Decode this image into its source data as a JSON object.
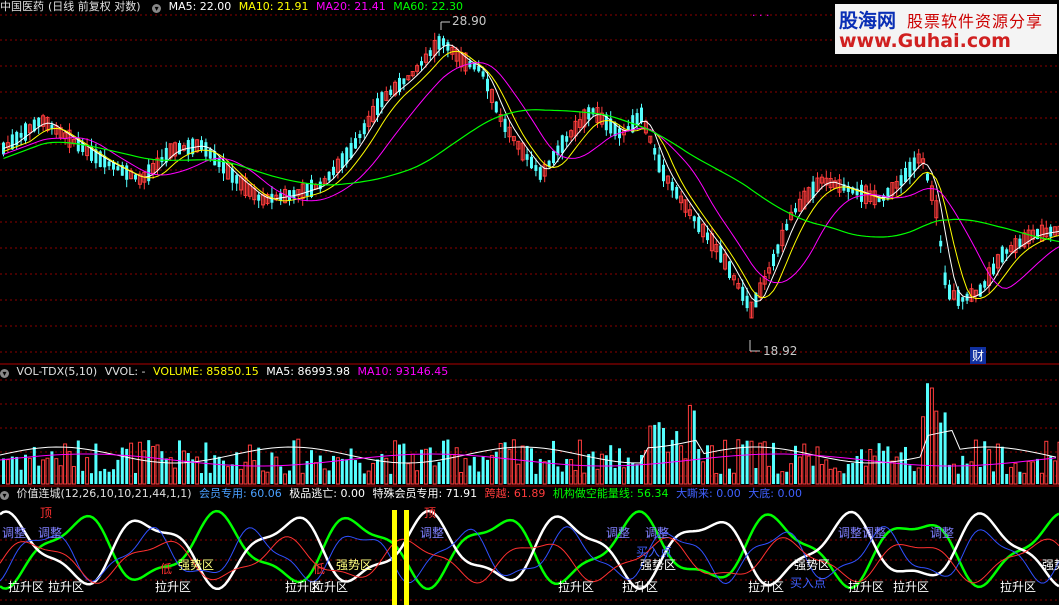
{
  "stock": {
    "name": "中国医药",
    "mode": "(日线 前复权 对数)"
  },
  "ma_header": {
    "ma5": "MA5: 22.00",
    "ma10": "MA10: 21.91",
    "ma20": "MA20: 21.41",
    "ma60": "MA60: 22.30",
    "dots": ". . ."
  },
  "price_marks": {
    "high": "28.90",
    "low": "18.92",
    "cai": "财"
  },
  "vol_header": {
    "name": "VOL-TDX(5,10)",
    "vvol": "VVOL: -",
    "volume": "VOLUME: 85850.15",
    "ma5": "MA5: 86993.98",
    "ma10": "MA10: 93146.45"
  },
  "ind_header": {
    "name": "价值连城(12,26,10,10,21,44,1,1)",
    "member": "会员专用: 60.06",
    "escape": "极品逃亡: 0.00",
    "special": "特殊会员专用: 71.91",
    "cross": "跨越: 61.89",
    "inst": "机构做空能量线: 56.34",
    "bigshort": "大嘶来: 0.00",
    "bigbottom": "大底: 0.00"
  },
  "logo": {
    "brand": "股海网",
    "tagline": "股票软件资源分享",
    "url": "www.Guhai.com"
  },
  "ind_labels": {
    "adjust": "调整",
    "pull": "拉升区",
    "strong": "强势区",
    "top": "顶",
    "low": "低",
    "buy": "买入点"
  },
  "colors": {
    "up": "#ff3c3c",
    "down": "#54ffff",
    "ma5": "#ffffff",
    "ma10": "#ffff00",
    "ma20": "#ff00ff",
    "ma60": "#00ff00",
    "grid": "#8b0000",
    "vol_ma5": "#ffffff",
    "vol_ma10": "#ffff00"
  }
}
